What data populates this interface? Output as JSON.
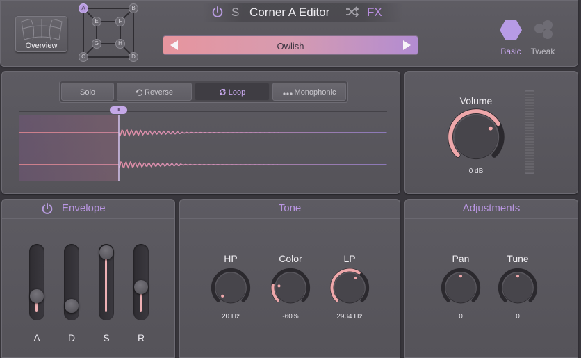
{
  "header": {
    "overview_label": "Overview",
    "corner_nodes": [
      "A",
      "B",
      "C",
      "D",
      "E",
      "F",
      "G",
      "H"
    ],
    "active_corner": "A",
    "solo_letter": "S",
    "title": "Corner A Editor",
    "fx_label": "FX",
    "preset_name": "Owlish",
    "modes": [
      {
        "label": "Basic",
        "active": true
      },
      {
        "label": "Tweak",
        "active": false
      }
    ]
  },
  "sample": {
    "buttons": [
      {
        "label": "Solo",
        "icon": "",
        "active": false
      },
      {
        "label": "Reverse",
        "icon": "undo-arrow-icon",
        "active": false
      },
      {
        "label": "Loop",
        "icon": "loop-icon",
        "active": true
      },
      {
        "label": "Monophonic",
        "icon": "dots-icon",
        "active": false
      }
    ],
    "handle_glyph": "III"
  },
  "volume": {
    "title": "Volume",
    "value": "0 dB",
    "level": 0.72
  },
  "envelope": {
    "title": "Envelope",
    "sliders": [
      {
        "label": "A",
        "value": 0.27
      },
      {
        "label": "D",
        "value": 0.1
      },
      {
        "label": "S",
        "value": 1.0
      },
      {
        "label": "R",
        "value": 0.42
      }
    ]
  },
  "tone": {
    "title": "Tone",
    "knobs": [
      {
        "label": "HP",
        "value": "20 Hz",
        "level": 0.0
      },
      {
        "label": "Color",
        "value": "-60%",
        "level": 0.2
      },
      {
        "label": "LP",
        "value": "2934 Hz",
        "level": 0.62
      }
    ]
  },
  "adjustments": {
    "title": "Adjustments",
    "knobs": [
      {
        "label": "Pan",
        "value": "0",
        "level": 0.5
      },
      {
        "label": "Tune",
        "value": "0",
        "level": 0.5
      }
    ]
  },
  "colors": {
    "accent": "#b996e2",
    "arc": "#eea7aa",
    "preset_start": "#e7959e",
    "preset_end": "#b28cd2"
  }
}
